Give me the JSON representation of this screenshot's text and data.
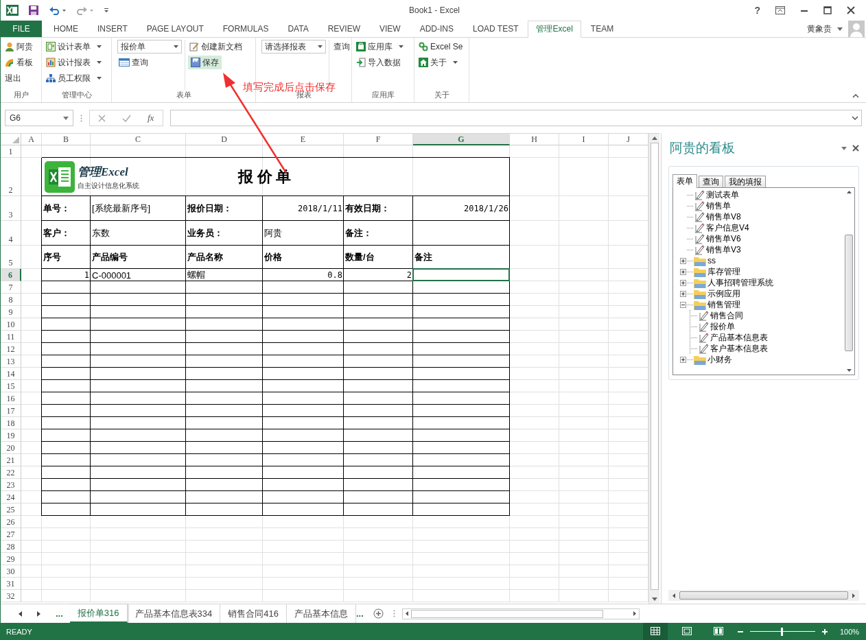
{
  "window": {
    "title": "Book1 - Excel",
    "help": "?"
  },
  "ribbon_tabs": [
    {
      "label": "FILE",
      "kind": "file",
      "selected": false
    },
    {
      "label": "HOME",
      "kind": "tab",
      "selected": false
    },
    {
      "label": "INSERT",
      "kind": "tab",
      "selected": false
    },
    {
      "label": "PAGE LAYOUT",
      "kind": "tab",
      "selected": false
    },
    {
      "label": "FORMULAS",
      "kind": "tab",
      "selected": false
    },
    {
      "label": "DATA",
      "kind": "tab",
      "selected": false
    },
    {
      "label": "REVIEW",
      "kind": "tab",
      "selected": false
    },
    {
      "label": "VIEW",
      "kind": "tab",
      "selected": false
    },
    {
      "label": "ADD-INS",
      "kind": "tab",
      "selected": false
    },
    {
      "label": "LOAD TEST",
      "kind": "tab",
      "selected": false
    },
    {
      "label": "管理Excel",
      "kind": "tab",
      "selected": true
    },
    {
      "label": "TEAM",
      "kind": "tab",
      "selected": false
    }
  ],
  "user": {
    "name": "黄象贵"
  },
  "ribbon": {
    "user": {
      "label": "用户",
      "buttons": [
        "阿贵",
        "看板",
        "退出"
      ]
    },
    "admin": {
      "label": "管理中心",
      "menus": [
        "设计表单",
        "设计报表",
        "员工权限"
      ]
    },
    "forms": {
      "label": "表单",
      "dropdown": "报价单",
      "query": "查询",
      "new_doc": "创建新文档",
      "save": {
        "label": "保存",
        "highlighted": true
      }
    },
    "reports": {
      "label": "报表",
      "dropdown": "请选择报表",
      "query": "查询"
    },
    "apps": {
      "label": "应用库",
      "library": "应用库",
      "import": "导入数据"
    },
    "about": {
      "label": "关于",
      "server": "Excel Se",
      "about": "关于"
    }
  },
  "annotation": {
    "text": "填写完成后点击保存"
  },
  "formula_bar": {
    "name_box": "G6",
    "fx": "fx"
  },
  "sheet": {
    "columns": [
      {
        "label": "A",
        "selected": false
      },
      {
        "label": "B",
        "selected": false
      },
      {
        "label": "C",
        "selected": false
      },
      {
        "label": "D",
        "selected": false
      },
      {
        "label": "E",
        "selected": false
      },
      {
        "label": "F",
        "selected": false
      },
      {
        "label": "G",
        "selected": true
      },
      {
        "label": "H",
        "selected": false
      },
      {
        "label": "I",
        "selected": false
      },
      {
        "label": "J",
        "selected": false
      }
    ],
    "rows": [
      {
        "label": "1",
        "selected": false
      },
      {
        "label": "2",
        "selected": false
      },
      {
        "label": "3",
        "selected": false
      },
      {
        "label": "4",
        "selected": false
      },
      {
        "label": "5",
        "selected": false
      },
      {
        "label": "6",
        "selected": true
      },
      {
        "label": "7",
        "selected": false
      },
      {
        "label": "8",
        "selected": false
      },
      {
        "label": "9",
        "selected": false
      },
      {
        "label": "10",
        "selected": false
      },
      {
        "label": "11",
        "selected": false
      },
      {
        "label": "12",
        "selected": false
      },
      {
        "label": "13",
        "selected": false
      },
      {
        "label": "14",
        "selected": false
      },
      {
        "label": "15",
        "selected": false
      },
      {
        "label": "16",
        "selected": false
      },
      {
        "label": "17",
        "selected": false
      },
      {
        "label": "18",
        "selected": false
      },
      {
        "label": "19",
        "selected": false
      },
      {
        "label": "20",
        "selected": false
      },
      {
        "label": "21",
        "selected": false
      },
      {
        "label": "22",
        "selected": false
      },
      {
        "label": "23",
        "selected": false
      },
      {
        "label": "24",
        "selected": false
      },
      {
        "label": "25",
        "selected": false
      },
      {
        "label": "26",
        "selected": false
      },
      {
        "label": "27",
        "selected": false
      },
      {
        "label": "28",
        "selected": false
      },
      {
        "label": "29",
        "selected": false
      },
      {
        "label": "30",
        "selected": false
      },
      {
        "label": "31",
        "selected": false
      },
      {
        "label": "32",
        "selected": false
      }
    ],
    "logo": {
      "name": "管理Excel",
      "tagline": "自主设计信息化系统"
    },
    "title": "报 价 单",
    "form_rows": [
      [
        {
          "text": "单号：",
          "bold": true,
          "kind": "text"
        },
        {
          "text": "[系统最新序号]",
          "bold": false,
          "kind": "text"
        },
        {
          "text": "报价日期：",
          "bold": true,
          "kind": "text"
        },
        {
          "text": "2018/1/11",
          "bold": false,
          "kind": "number"
        },
        {
          "text": "有效日期：",
          "bold": true,
          "kind": "text"
        },
        {
          "text": "2018/1/26",
          "bold": false,
          "kind": "number"
        }
      ],
      [
        {
          "text": "客户：",
          "bold": true,
          "kind": "text"
        },
        {
          "text": "东数",
          "bold": false,
          "kind": "text"
        },
        {
          "text": "业务员：",
          "bold": true,
          "kind": "text"
        },
        {
          "text": "阿贵",
          "bold": false,
          "kind": "text"
        },
        {
          "text": "备注：",
          "bold": true,
          "kind": "text"
        }
      ],
      [
        {
          "text": "序号",
          "bold": true,
          "kind": "text"
        },
        {
          "text": "产品编号",
          "bold": true,
          "kind": "text"
        },
        {
          "text": "产品名称",
          "bold": true,
          "kind": "text"
        },
        {
          "text": "价格",
          "bold": true,
          "kind": "text"
        },
        {
          "text": "数量/台",
          "bold": true,
          "kind": "text"
        },
        {
          "text": "备注",
          "bold": true,
          "kind": "text"
        }
      ]
    ],
    "items": [
      [
        {
          "text": "1",
          "kind": "number",
          "selected": false
        },
        {
          "text": "C-000001",
          "kind": "text",
          "selected": false
        },
        {
          "text": "螺帽",
          "kind": "text",
          "selected": false
        },
        {
          "text": "0.8",
          "kind": "number",
          "selected": false
        },
        {
          "text": "2",
          "kind": "number",
          "selected": false
        },
        {
          "kind": "text",
          "selected": true
        }
      ]
    ]
  },
  "sheet_tabs": {
    "more_left": "...",
    "tabs": [
      {
        "label": "报价单316",
        "selected": true
      },
      {
        "label": "产品基本信息表334",
        "selected": false
      },
      {
        "label": "销售合同416",
        "selected": false
      },
      {
        "label": "产品基本信息",
        "selected": false
      }
    ],
    "more_right": "..."
  },
  "panel": {
    "title": "阿贵的看板",
    "tabs": [
      {
        "label": "表单",
        "selected": true
      },
      {
        "label": "查询",
        "selected": false
      },
      {
        "label": "我的填报",
        "selected": false
      }
    ],
    "tree": [
      {
        "label": "测试表单",
        "kind": "form"
      },
      {
        "label": "销售单",
        "kind": "form"
      },
      {
        "label": "销售单V8",
        "kind": "form"
      },
      {
        "label": "客户信息V4",
        "kind": "form"
      },
      {
        "label": "销售单V6",
        "kind": "form"
      },
      {
        "label": "销售单V3",
        "kind": "form"
      },
      {
        "label": "ss",
        "kind": "folder",
        "expanded": false
      },
      {
        "label": "库存管理",
        "kind": "folder",
        "expanded": false
      },
      {
        "label": "人事招聘管理系统",
        "kind": "folder",
        "expanded": false
      },
      {
        "label": "示例应用",
        "kind": "folder",
        "expanded": false
      },
      {
        "label": "销售管理",
        "kind": "folder",
        "expanded": true,
        "children": [
          {
            "label": "销售合同",
            "kind": "form"
          },
          {
            "label": "报价单",
            "kind": "form"
          },
          {
            "label": "产品基本信息表",
            "kind": "form"
          },
          {
            "label": "客户基本信息表",
            "kind": "form"
          }
        ]
      },
      {
        "label": "小财务",
        "kind": "folder",
        "expanded": false
      }
    ]
  },
  "status_bar": {
    "status": "READY",
    "views": [
      {
        "kind": "normal",
        "selected": true
      },
      {
        "kind": "page_layout",
        "selected": false
      },
      {
        "kind": "page_break",
        "selected": false
      }
    ],
    "zoom": {
      "level": 0.48,
      "label": "100%"
    }
  }
}
